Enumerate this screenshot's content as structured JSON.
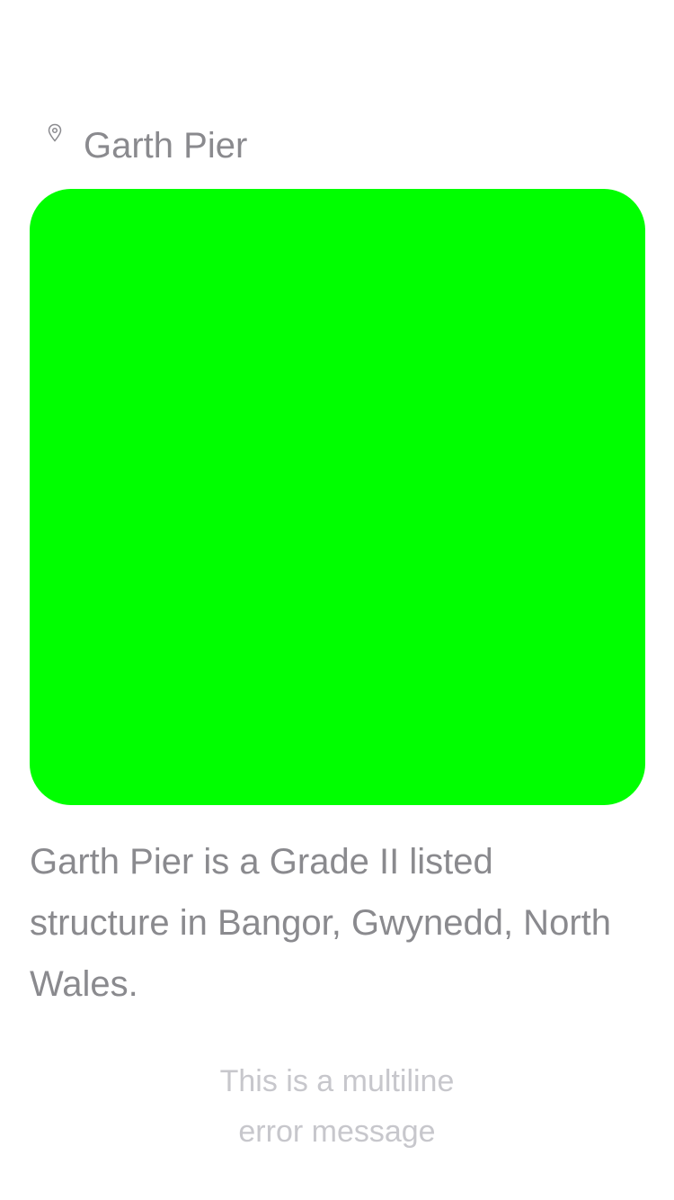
{
  "location": {
    "icon": "map-pin-icon",
    "name": "Garth Pier"
  },
  "image_card": {
    "color": "#00ff00"
  },
  "description": "Garth Pier is a Grade II listed structure in Bangor, Gwynedd, North Wales.",
  "error": {
    "line1": "This is a multiline",
    "line2": "error message"
  },
  "colors": {
    "text_secondary": "#8a8a8e",
    "text_tertiary": "#c7c7cc",
    "placeholder_green": "#00ff00"
  }
}
